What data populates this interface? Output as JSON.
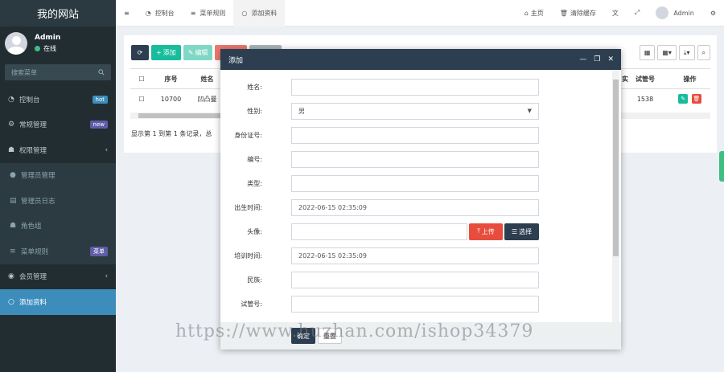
{
  "sidebar": {
    "logo": "我的网站",
    "user": {
      "name": "Admin",
      "status": "在线"
    },
    "search_placeholder": "搜索菜单",
    "items": [
      {
        "label": "控制台",
        "badge": "hot"
      },
      {
        "label": "常规管理",
        "badge": "new"
      },
      {
        "label": "权限管理",
        "arrow": "‹"
      },
      {
        "label": "管理员管理"
      },
      {
        "label": "管理员日志"
      },
      {
        "label": "角色组"
      },
      {
        "label": "菜单规则",
        "badge": "菜单"
      },
      {
        "label": "会员管理",
        "arrow": "‹"
      },
      {
        "label": "添加资料"
      }
    ]
  },
  "topbar": {
    "menu_icon": "≡",
    "tabs": [
      {
        "label": "控制台"
      },
      {
        "label": "菜单规则"
      },
      {
        "label": "添加资料"
      }
    ],
    "right": {
      "home": "主页",
      "clear_cache": "清除缓存",
      "user": "Admin"
    }
  },
  "toolbar": {
    "add": "添加",
    "edit": "编辑"
  },
  "table": {
    "headers": {
      "id": "序号",
      "name": "姓名",
      "exam_no": "试管号",
      "ops": "操作"
    },
    "row": {
      "id": "10700",
      "name": "凹凸曼",
      "exam_no": "1538"
    },
    "partial_header": "实"
  },
  "record_info": "显示第 1 到第 1 条记录，总",
  "modal": {
    "title": "添加",
    "fields": {
      "name": {
        "label": "姓名:",
        "value": ""
      },
      "gender": {
        "label": "性别:",
        "value": "男"
      },
      "id_card": {
        "label": "身份证号:",
        "value": ""
      },
      "number": {
        "label": "编号:",
        "value": ""
      },
      "type": {
        "label": "类型:",
        "value": ""
      },
      "birth": {
        "label": "出生时间:",
        "value": "2022-06-15 02:35:09"
      },
      "avatar": {
        "label": "头像:",
        "value": ""
      },
      "train_time": {
        "label": "培训时间:",
        "value": "2022-06-15 02:35:09"
      },
      "nation": {
        "label": "民族:",
        "value": ""
      },
      "exam_no": {
        "label": "试管号:",
        "value": ""
      }
    },
    "upload": "上传",
    "choose": "选择",
    "ok": "确定",
    "reset": "重置"
  },
  "watermark": "https://www.huzhan.com/ishop34379"
}
